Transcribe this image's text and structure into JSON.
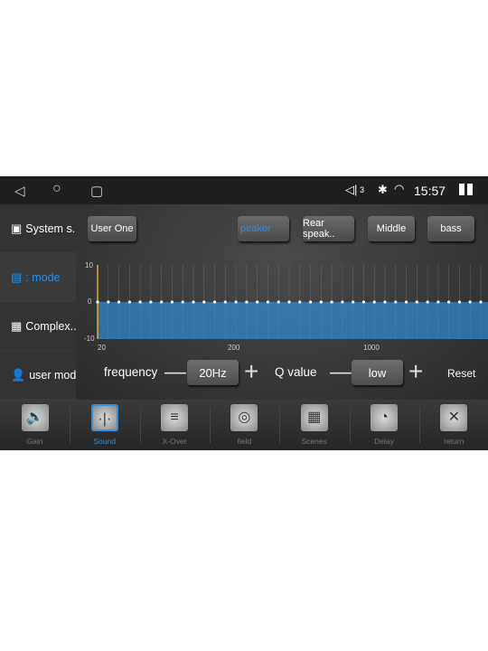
{
  "status": {
    "volume_level": "3",
    "time": "15:57"
  },
  "sidebar": {
    "items": [
      {
        "label": "System s..",
        "icon": "waveform-icon"
      },
      {
        "label": ": mode",
        "icon": "mode-icon",
        "active": true
      },
      {
        "label": "Complex..",
        "icon": "grid-icon"
      },
      {
        "label": "user mod..",
        "icon": "user-icon"
      }
    ]
  },
  "presets": {
    "user": "User One",
    "channels": [
      "peaker",
      "Rear speak..",
      "Middle",
      "bass"
    ],
    "selected_channel": "peaker"
  },
  "eq": {
    "y_ticks": [
      "10",
      "0",
      "-10"
    ],
    "x_ticks": [
      "20",
      "200",
      "1000"
    ],
    "ylim": [
      -10,
      10
    ],
    "band_gains_db": [
      0,
      0,
      0,
      0,
      0,
      0,
      0,
      0,
      0,
      0,
      0,
      0,
      0,
      0,
      0,
      0,
      0,
      0,
      0,
      0,
      0,
      0,
      0,
      0,
      0,
      0,
      0,
      0,
      0,
      0,
      0,
      0,
      0,
      0,
      0,
      0,
      0
    ]
  },
  "controls": {
    "frequency_label": "frequency",
    "frequency_value": "20Hz",
    "q_label": "Q value",
    "q_value": "low",
    "reset": "Reset",
    "minus": "—",
    "plus": "+"
  },
  "toolbar": {
    "items": [
      {
        "label": "Gain",
        "glyph": "🔊"
      },
      {
        "label": "Sound",
        "glyph": "·|·"
      },
      {
        "label": "X-Over",
        "glyph": "≡"
      },
      {
        "label": "field",
        "glyph": "◎"
      },
      {
        "label": "Scenes",
        "glyph": "▦"
      },
      {
        "label": "Delay",
        "glyph": "◔"
      },
      {
        "label": "return",
        "glyph": "✕"
      }
    ],
    "selected": "Sound"
  },
  "colors": {
    "accent": "#2f8fe0",
    "marker": "#e0b020"
  }
}
